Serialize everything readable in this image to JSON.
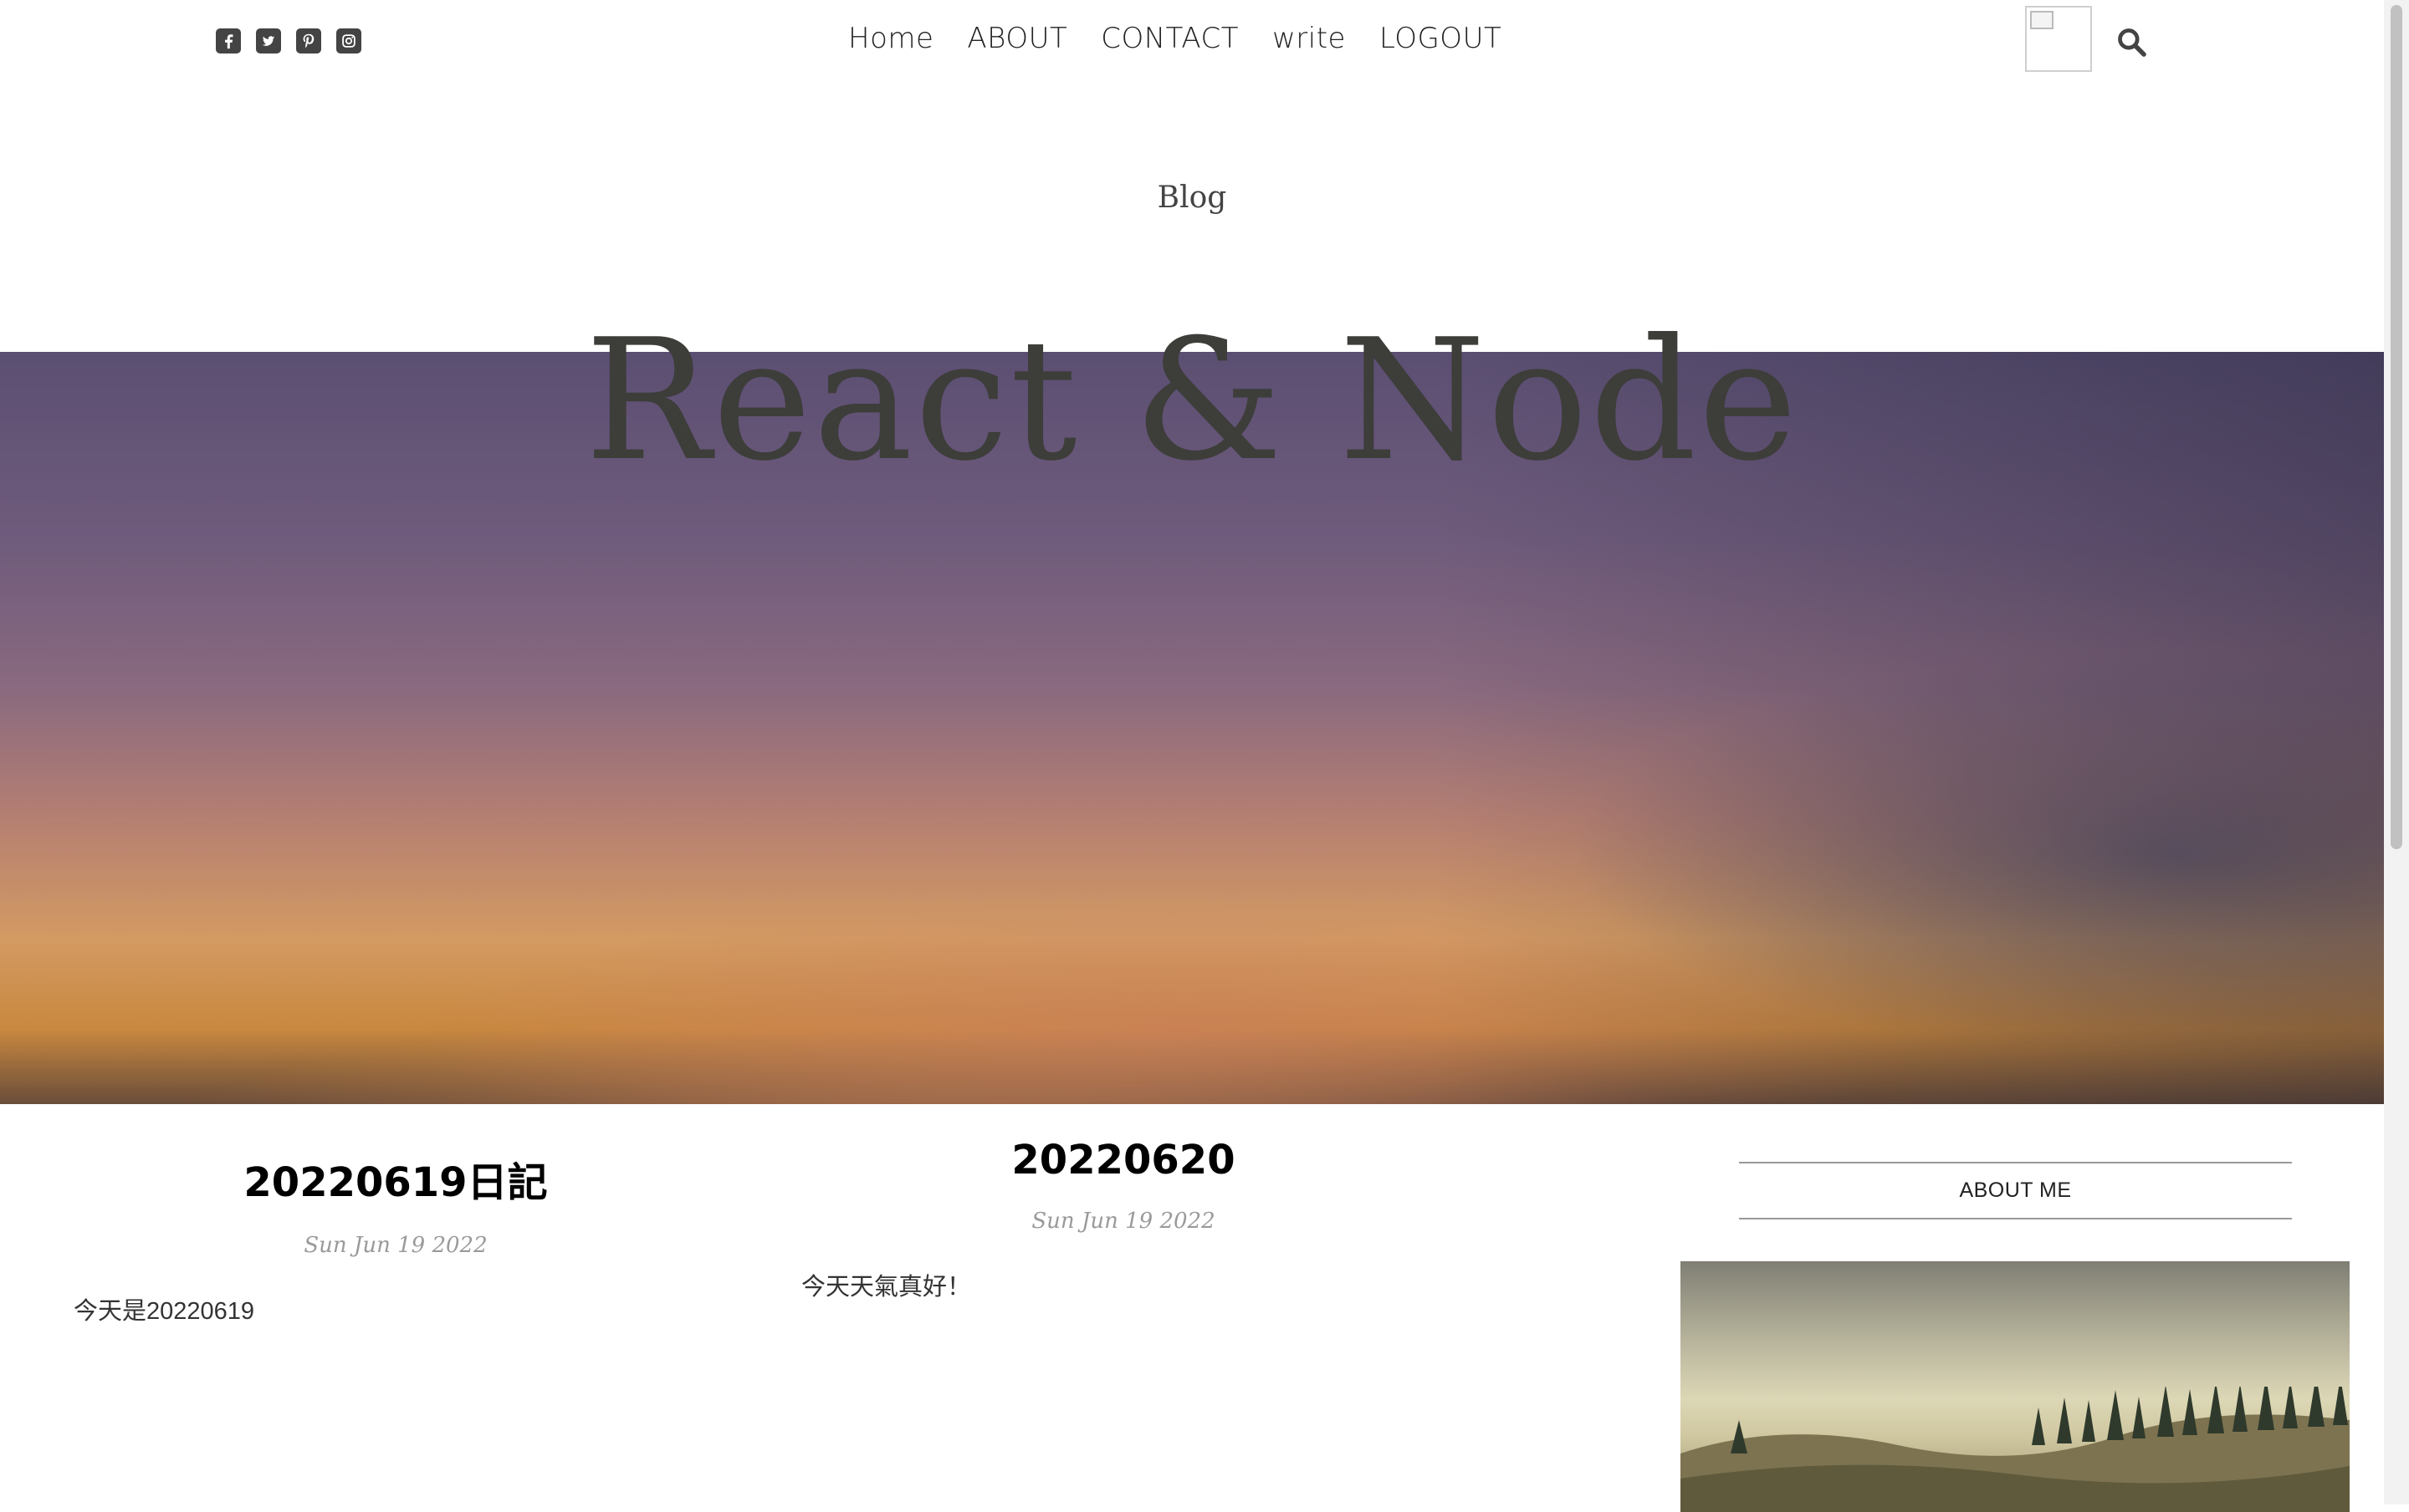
{
  "social": {
    "icons": [
      "facebook-square-icon",
      "twitter-square-icon",
      "pinterest-square-icon",
      "instagram-square-icon"
    ]
  },
  "nav": {
    "items": [
      "Home",
      "ABOUT",
      "CONTACT",
      "write",
      "LOGOUT"
    ]
  },
  "header": {
    "small_title": "Blog",
    "large_title": "React & Node"
  },
  "posts": [
    {
      "title": "20220619日記",
      "date": "Sun Jun 19 2022",
      "description": "今天是20220619"
    },
    {
      "title": "20220620",
      "date": "Sun Jun 19 2022",
      "description": "今天天氣真好！"
    }
  ],
  "sidebar": {
    "heading": "ABOUT ME"
  },
  "colors": {
    "nav_text": "#222222",
    "icon": "#444444",
    "date": "#9a9a9a"
  }
}
